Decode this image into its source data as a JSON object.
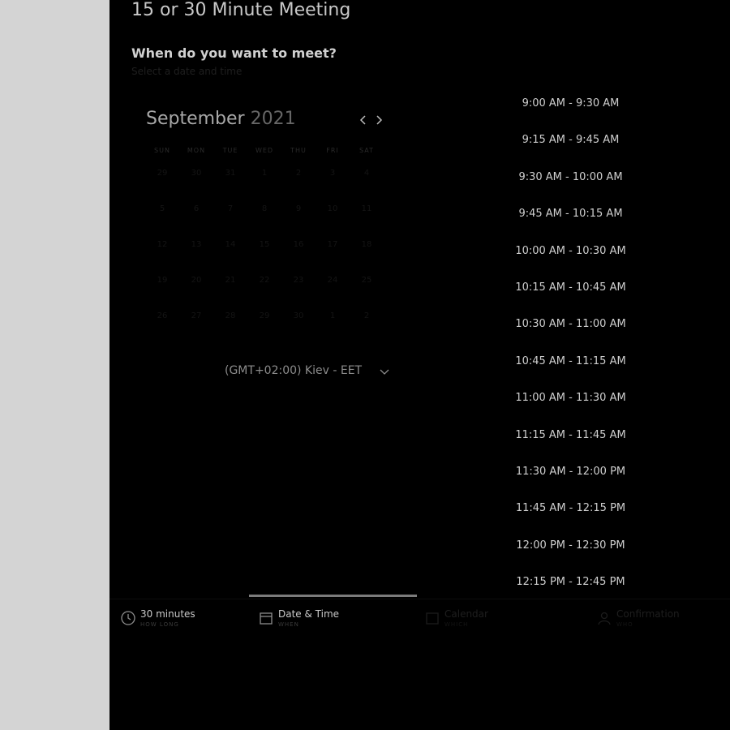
{
  "page": {
    "title": "15 or 30 Minute Meeting",
    "question": "When do you want to meet?",
    "hint": "Select a date and time"
  },
  "calendar": {
    "month": "September",
    "year": "2021",
    "weekdays": [
      "SUN",
      "MON",
      "TUE",
      "WED",
      "THU",
      "FRI",
      "SAT"
    ],
    "weeks": [
      [
        "29",
        "30",
        "31",
        "1",
        "2",
        "3",
        "4"
      ],
      [
        "5",
        "6",
        "7",
        "8",
        "9",
        "10",
        "11"
      ],
      [
        "12",
        "13",
        "14",
        "15",
        "16",
        "17",
        "18"
      ],
      [
        "19",
        "20",
        "21",
        "22",
        "23",
        "24",
        "25"
      ],
      [
        "26",
        "27",
        "28",
        "29",
        "30",
        "1",
        "2"
      ]
    ]
  },
  "timezone": {
    "label": "(GMT+02:00) Kiev - EET"
  },
  "slots": [
    "9:00 AM - 9:30 AM",
    "9:15 AM - 9:45 AM",
    "9:30 AM - 10:00 AM",
    "9:45 AM - 10:15 AM",
    "10:00 AM - 10:30 AM",
    "10:15 AM - 10:45 AM",
    "10:30 AM - 11:00 AM",
    "10:45 AM - 11:15 AM",
    "11:00 AM - 11:30 AM",
    "11:15 AM - 11:45 AM",
    "11:30 AM - 12:00 PM",
    "11:45 AM - 12:15 PM",
    "12:00 PM - 12:30 PM",
    "12:15 PM - 12:45 PM"
  ],
  "steps": [
    {
      "label": "30 minutes",
      "sub": "HOW LONG",
      "icon": "clock-icon"
    },
    {
      "label": "Date & Time",
      "sub": "WHEN",
      "icon": "calendar-icon"
    },
    {
      "label": "Calendar",
      "sub": "WHICH",
      "icon": "calendar-check-icon"
    },
    {
      "label": "Confirmation",
      "sub": "WHO",
      "icon": "person-icon"
    }
  ]
}
